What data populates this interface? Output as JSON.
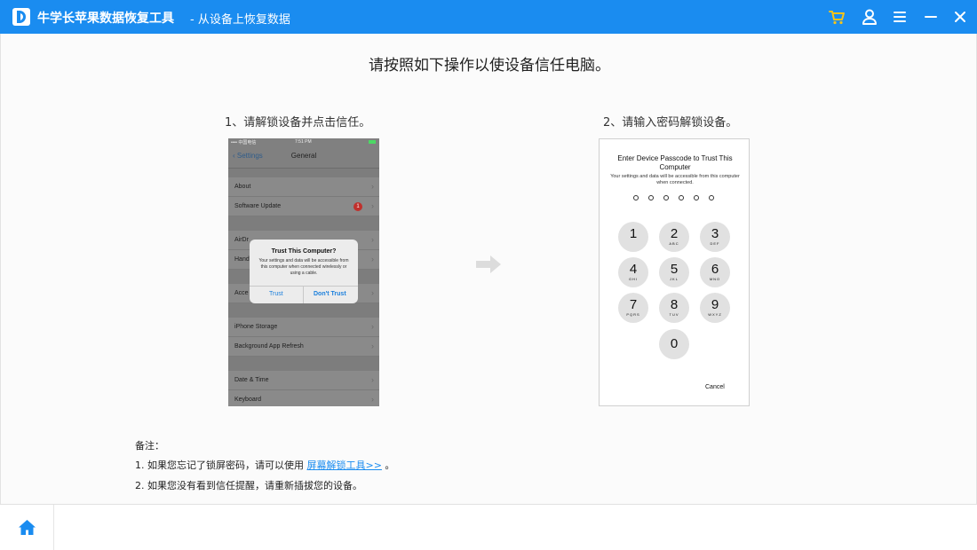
{
  "titlebar": {
    "app_name": "牛学长苹果数据恢复工具",
    "subtitle": "-  从设备上恢复数据",
    "accent": "#1a8cf0",
    "cart_color": "#f4c41b",
    "icons": [
      "cart-icon",
      "user-icon",
      "menu-icon",
      "minimize-icon",
      "close-icon"
    ]
  },
  "main": {
    "heading": "请按照如下操作以使设备信任电脑。",
    "step1": "1、请解锁设备并点击信任。",
    "step2": "2、请输入密码解锁设备。"
  },
  "phone1": {
    "carrier": "•••• 中国电信  ",
    "time": "7:51 PM",
    "back": "Settings",
    "nav_title": "General",
    "rows": [
      "About",
      "Software Update",
      "AirDr",
      "Hand",
      "Acce",
      "iPhone Storage",
      "Background App Refresh",
      "Date & Time",
      "Keyboard"
    ],
    "badge": "1",
    "dialog": {
      "title": "Trust This Computer?",
      "message": "Your settings and data will be accessible from this computer when connected wirelessly or using a cable.",
      "trust": "Trust",
      "dont_trust": "Don't Trust"
    }
  },
  "phone2": {
    "title": "Enter Device Passcode to Trust This Computer",
    "message": "Your settings and data will be accessible from this computer when connected.",
    "keys": [
      {
        "n": "1",
        "s": ""
      },
      {
        "n": "2",
        "s": "ABC"
      },
      {
        "n": "3",
        "s": "DEF"
      },
      {
        "n": "4",
        "s": "GHI"
      },
      {
        "n": "5",
        "s": "JKL"
      },
      {
        "n": "6",
        "s": "MNO"
      },
      {
        "n": "7",
        "s": "PQRS"
      },
      {
        "n": "8",
        "s": "TUV"
      },
      {
        "n": "9",
        "s": "WXYZ"
      },
      {
        "n": "0",
        "s": ""
      }
    ],
    "cancel": "Cancel"
  },
  "notes": {
    "label": "备注：",
    "line1_prefix": "1. 如果您忘记了锁屏密码，请可以使用 ",
    "line1_link": "屏幕解锁工具>>",
    "line1_suffix": " 。",
    "line2": "2. 如果您没有看到信任提醒，请重新插拔您的设备。"
  },
  "bottombar": {
    "home_icon": "home-icon"
  }
}
